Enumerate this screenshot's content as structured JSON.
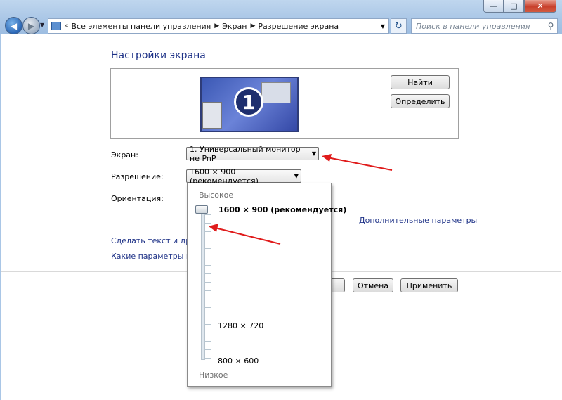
{
  "window": {
    "minimize_glyph": "—",
    "maximize_glyph": "□",
    "close_glyph": "✕"
  },
  "nav": {
    "back_icon": "arrow-left",
    "forward_icon": "arrow-right",
    "breadcrumbs": [
      "Все элементы панели управления",
      "Экран",
      "Разрешение экрана"
    ],
    "search_placeholder": "Поиск в панели управления"
  },
  "page": {
    "title": "Настройки экрана",
    "monitor_number": "1",
    "find_label": "Найти",
    "identify_label": "Определить",
    "screen_label": "Экран:",
    "screen_value": "1. Универсальный монитор не PnP",
    "resolution_label": "Разрешение:",
    "resolution_value": "1600 × 900 (рекомендуется)",
    "orientation_label": "Ориентация:",
    "advanced_link": "Дополнительные параметры",
    "text_link": "Сделать текст и други",
    "monitor_link": "Какие параметры мон",
    "ok_label": "",
    "cancel_label": "Отмена",
    "apply_label": "Применить"
  },
  "popup": {
    "high_label": "Высокое",
    "low_label": "Низкое",
    "options": [
      "1600 × 900 (рекомендуется)",
      "1280 × 720",
      "800 × 600"
    ],
    "selected_level": 1.0
  },
  "colors": {
    "accent_link": "#1e3287",
    "annotation_arrow": "#e01b1b"
  }
}
